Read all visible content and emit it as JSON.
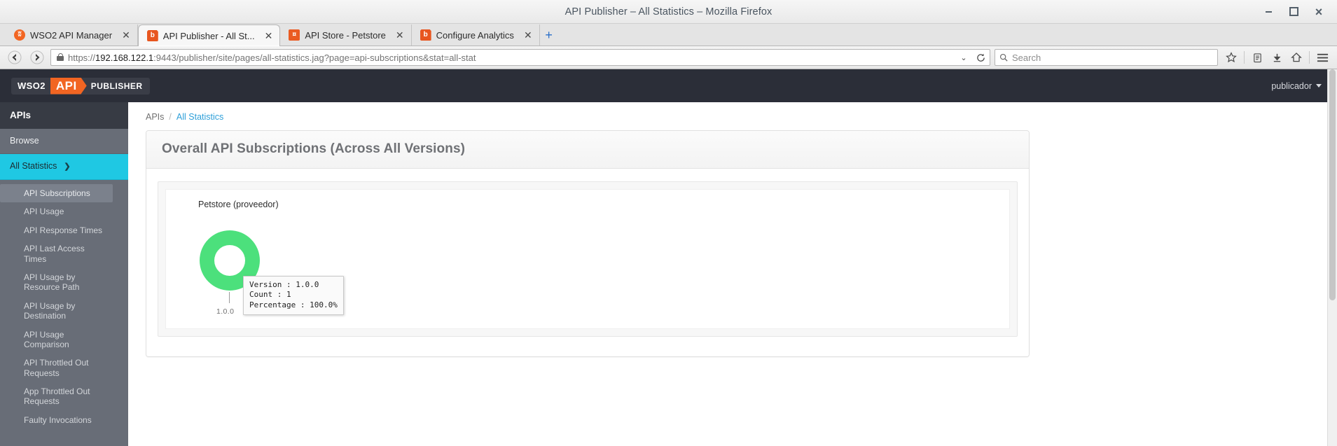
{
  "window": {
    "title": "API Publisher – All Statistics – Mozilla Firefox",
    "minimize_label": "",
    "maximize_label": "",
    "close_label": ""
  },
  "tabs": [
    {
      "label": "WSO2 API Manager",
      "favicon": "wso2-icon",
      "favicon_text": "ʬ",
      "close": "✕",
      "active": false
    },
    {
      "label": "API Publisher - All St...",
      "favicon": "publisher-icon",
      "favicon_text": "b",
      "close": "✕",
      "active": true
    },
    {
      "label": "API Store - Petstore",
      "favicon": "store-icon",
      "favicon_text": "¤",
      "close": "✕",
      "active": false
    },
    {
      "label": "Configure Analytics",
      "favicon": "publisher-icon",
      "favicon_text": "b",
      "close": "✕",
      "active": false
    }
  ],
  "newtab_label": "+",
  "navbar": {
    "back_icon": "back-arrow-icon",
    "forward_icon": "forward-arrow-icon",
    "lock_icon": "padlock-icon",
    "url_scheme": "https://",
    "url_host": "192.168.122.1",
    "url_rest": ":9443/publisher/site/pages/all-statistics.jag?page=api-subscriptions&stat=all-stat",
    "url_full": "https://192.168.122.1:9443/publisher/site/pages/all-statistics.jag?page=api-subscriptions&stat=all-stat",
    "dropdown_caret": "⌄",
    "reload_icon": "reload-icon",
    "search_placeholder": "Search",
    "search_value": "",
    "icons": [
      "bookmark-star-icon",
      "reader-list-icon",
      "download-arrow-icon",
      "home-icon",
      "hamburger-menu-icon"
    ]
  },
  "app": {
    "logo": {
      "prefix": "WSO2",
      "accent": "API",
      "suffix": "PUBLISHER",
      "accent_color": "#f26522"
    },
    "user": "publicador",
    "header_bg": "#2b2e38"
  },
  "sidebar": {
    "title": "APIs",
    "items": [
      {
        "label": "Browse",
        "active": false
      },
      {
        "label": "All Statistics",
        "active": true,
        "chevron": "❯"
      }
    ],
    "sub_items": [
      {
        "label": "API Subscriptions",
        "selected": true
      },
      {
        "label": "API Usage",
        "selected": false
      },
      {
        "label": "API Response Times",
        "selected": false
      },
      {
        "label": "API Last Access Times",
        "selected": false
      },
      {
        "label": "API Usage by Resource Path",
        "selected": false
      },
      {
        "label": "API Usage by Destination",
        "selected": false
      },
      {
        "label": "API Usage Comparison",
        "selected": false
      },
      {
        "label": "API Throttled Out Requests",
        "selected": false
      },
      {
        "label": "App Throttled Out Requests",
        "selected": false
      },
      {
        "label": "Faulty Invocations",
        "selected": false
      }
    ],
    "active_color": "#1fc8e3"
  },
  "breadcrumb": {
    "root": "APIs",
    "separator": "/",
    "current": "All Statistics"
  },
  "panel": {
    "title": "Overall API Subscriptions (Across All Versions)"
  },
  "tooltip": {
    "version_line": "Version : 1.0.0",
    "count_line": "Count : 1",
    "percentage_line": "Percentage : 100.0%"
  },
  "chart_data": {
    "type": "pie",
    "title": "Petstore (proveedor)",
    "subtitle": "",
    "xlabel": "",
    "ylabel": "",
    "categories": [
      "1.0.0"
    ],
    "values": [
      1
    ],
    "percentages": [
      100.0
    ],
    "colors": [
      "#4ce07c"
    ],
    "slice_label": "1.0.0",
    "donut": true,
    "legend": "none",
    "grid": false,
    "annotations": [
      {
        "version": "1.0.0",
        "count": 1,
        "percentage": "100.0%"
      }
    ]
  }
}
